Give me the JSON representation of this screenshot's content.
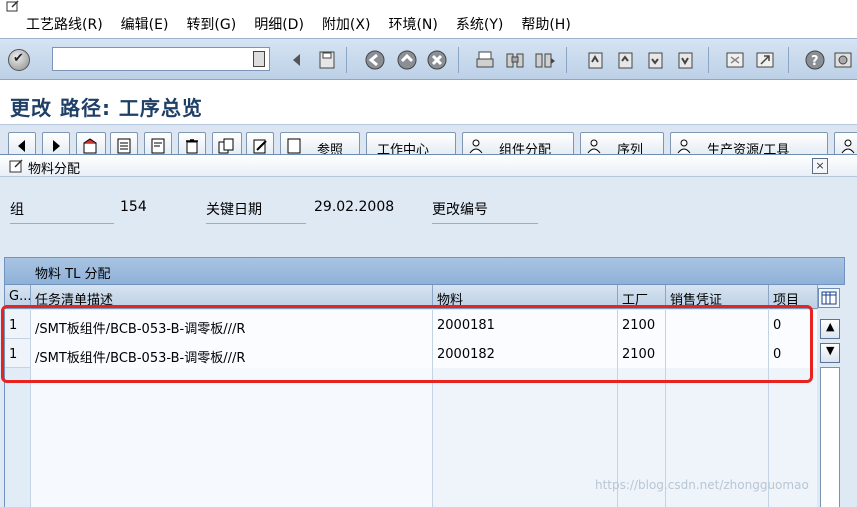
{
  "menu": [
    "工艺路线(R)",
    "编辑(E)",
    "转到(G)",
    "明细(D)",
    "附加(X)",
    "环境(N)",
    "系统(Y)",
    "帮助(H)"
  ],
  "toolbar": {
    "command_value": ""
  },
  "title": "更改 路径: 工序总览",
  "app_toolbar": [
    "参照",
    "工作中心",
    "组件分配",
    "序列",
    "生产资源/工具"
  ],
  "popup": {
    "title": "物料分配",
    "close": "×",
    "fields": {
      "group_label": "组",
      "group_value": "154",
      "key_date_label": "关键日期",
      "key_date_value": "29.02.2008",
      "change_no_label": "更改编号"
    },
    "table": {
      "caption": "物料 TL 分配",
      "columns": [
        "G...",
        "任务清单描述",
        "物料",
        "工厂",
        "销售凭证",
        "项目"
      ],
      "rows": [
        [
          "1",
          "/SMT板组件/BCB-053-B-调零板///R",
          "2000181",
          "2100",
          "",
          "0"
        ],
        [
          "1",
          "/SMT板组件/BCB-053-B-调零板///R",
          "2000182",
          "2100",
          "",
          "0"
        ]
      ]
    }
  },
  "watermark": "https://blog.csdn.net/zhongguomao",
  "colors": {
    "title": "#1e3f66",
    "highlight": "#e8221f",
    "caption_bg": "#a9c4e2"
  }
}
